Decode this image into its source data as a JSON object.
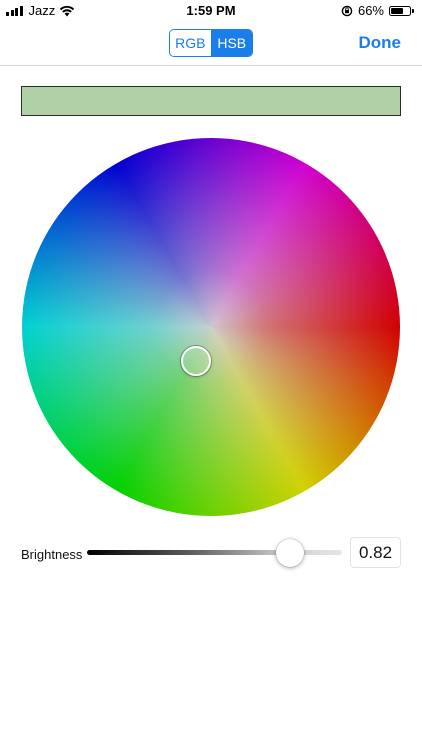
{
  "status_bar": {
    "carrier": "Jazz",
    "time": "1:59 PM",
    "battery_percent": "66%",
    "battery_level": 0.66,
    "icons": [
      "signal-icon",
      "wifi-icon",
      "orientation-lock-icon",
      "battery-icon"
    ]
  },
  "nav": {
    "segments": [
      "RGB",
      "HSB"
    ],
    "selected_segment": "HSB",
    "done_label": "Done",
    "accent_color": "#1a7ee8"
  },
  "color_preview": {
    "color": "#b0d0a8"
  },
  "hsb": {
    "brightness_label": "Brightness",
    "brightness_value": "0.82",
    "brightness_level": 0.82
  }
}
